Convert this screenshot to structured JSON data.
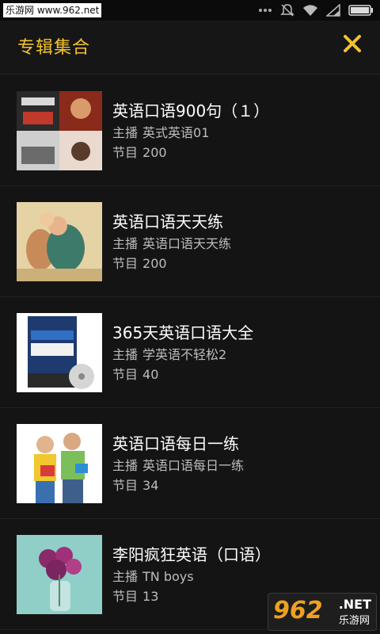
{
  "status_bar": {
    "watermark": "乐游网 www.962.net",
    "icons": [
      "dots-icon",
      "mute-icon",
      "wifi-icon",
      "signal-icon",
      "battery-icon"
    ]
  },
  "header": {
    "title": "专辑集合",
    "close_icon": "close-icon",
    "accent_color": "#f3c231"
  },
  "albums": [
    {
      "title": "英语口语900句（１）",
      "host_label": "主播",
      "host": "英式英语01",
      "count_label": "节目",
      "count": "200"
    },
    {
      "title": "英语口语天天练",
      "host_label": "主播",
      "host": "英语口语天天练",
      "count_label": "节目",
      "count": "200"
    },
    {
      "title": "365天英语口语大全",
      "host_label": "主播",
      "host": "学英语不轻松2",
      "count_label": "节目",
      "count": "40"
    },
    {
      "title": "英语口语每日一练",
      "host_label": "主播",
      "host": "英语口语每日一练",
      "count_label": "节目",
      "count": "34"
    },
    {
      "title": "李阳疯狂英语（口语）",
      "host_label": "主播",
      "host": "TN  boys",
      "count_label": "节目",
      "count": "13"
    }
  ],
  "watermark_logo": {
    "number": "962",
    "suffix": ".NET",
    "name": "乐游网"
  }
}
